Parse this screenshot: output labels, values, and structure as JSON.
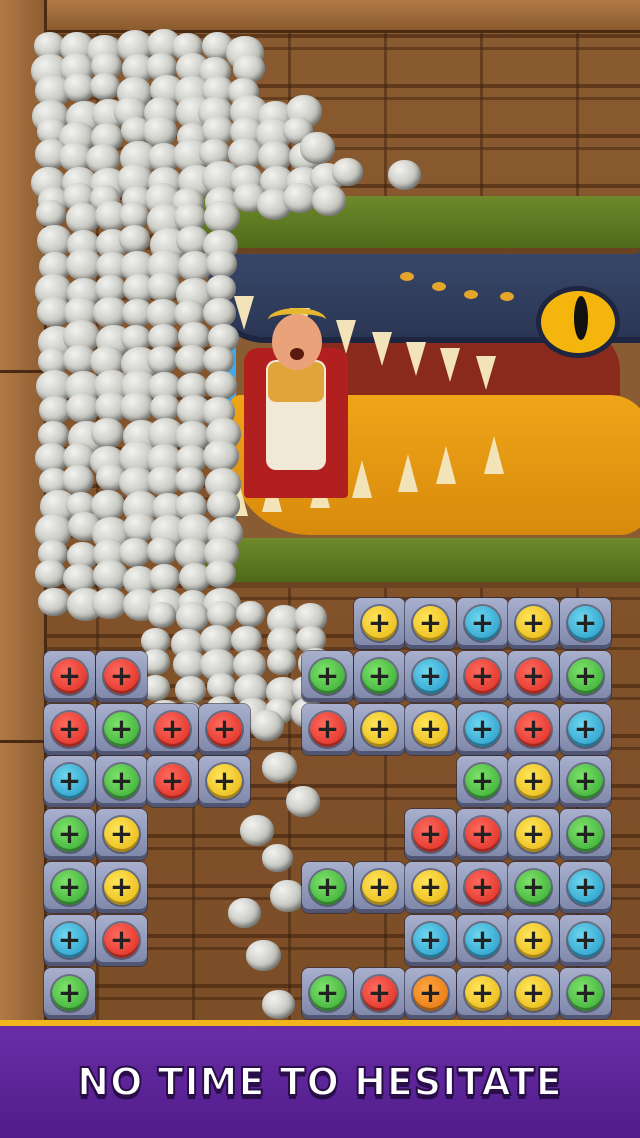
{
  "banner": {
    "text": "NO TIME TO HESITATE"
  },
  "colors": {
    "red": "#d9261c",
    "green": "#2fa42e",
    "blue": "#1d93c4",
    "yellow": "#e6b10c",
    "orange": "#e0700c",
    "banner_bg": "#5a2298",
    "banner_border": "#f2b51b"
  },
  "icons": {
    "screw_glyph": "+"
  },
  "board": {
    "rows": [
      [
        null,
        null,
        null,
        null,
        null,
        null,
        "yellow",
        "yellow",
        "blue",
        "yellow",
        "blue"
      ],
      [
        "red",
        "red",
        null,
        null,
        null,
        "green",
        "green",
        "blue",
        "red",
        "red",
        "green"
      ],
      [
        "red",
        "green",
        "red",
        "red",
        null,
        "red",
        "yellow",
        "yellow",
        "blue",
        "red",
        "blue"
      ],
      [
        "blue",
        "green",
        "red",
        "yellow",
        null,
        null,
        null,
        null,
        "green",
        "yellow",
        "green"
      ],
      [
        "green",
        "yellow",
        null,
        null,
        null,
        null,
        null,
        "red",
        "red",
        "yellow",
        "green"
      ],
      [
        "green",
        "yellow",
        null,
        null,
        null,
        "green",
        "yellow",
        "yellow",
        "red",
        "green",
        "blue"
      ],
      [
        "blue",
        "red",
        null,
        null,
        null,
        null,
        null,
        "blue",
        "blue",
        "yellow",
        "blue"
      ],
      [
        "green",
        null,
        null,
        null,
        null,
        "green",
        "red",
        "orange",
        "yellow",
        "yellow",
        "green"
      ]
    ]
  }
}
